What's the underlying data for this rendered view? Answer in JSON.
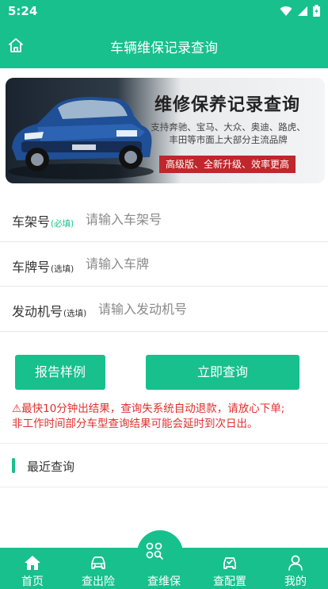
{
  "status_bar": {
    "time": "5:24"
  },
  "header": {
    "title": "车辆维保记录查询"
  },
  "banner": {
    "title": "维修保养记录查询",
    "subtitle_line1": "支持奔驰、宝马、大众、奥迪、路虎、",
    "subtitle_line2": "丰田等市面上大部分主流品牌",
    "tag": "高级版、全新升级、效率更高"
  },
  "form": {
    "vin": {
      "label": "车架号",
      "hint": "(必填)",
      "placeholder": "请输入车架号"
    },
    "plate": {
      "label": "车牌号",
      "hint": "(选填)",
      "placeholder": "请输入车牌"
    },
    "engine": {
      "label": "发动机号",
      "hint": "(选填)",
      "placeholder": "请输入发动机号"
    }
  },
  "buttons": {
    "sample": "报告样例",
    "query": "立即查询"
  },
  "notice": {
    "line1": "⚠最快10分钟出结果，查询失系统自动退款，请放心下单;",
    "line2": "非工作时间部分车型查询结果可能会延时到次日出。"
  },
  "recent": {
    "title": "最近查询"
  },
  "tabbar": {
    "items": [
      {
        "label": "首页",
        "icon": "home-icon"
      },
      {
        "label": "查出险",
        "icon": "car-icon"
      },
      {
        "label": "查维保",
        "icon": "search-grid-icon"
      },
      {
        "label": "查配置",
        "icon": "config-car-icon"
      },
      {
        "label": "我的",
        "icon": "user-icon"
      }
    ]
  },
  "colors": {
    "primary": "#17c08c",
    "warning": "#e02f2f",
    "banner_tag": "#c0262b"
  }
}
